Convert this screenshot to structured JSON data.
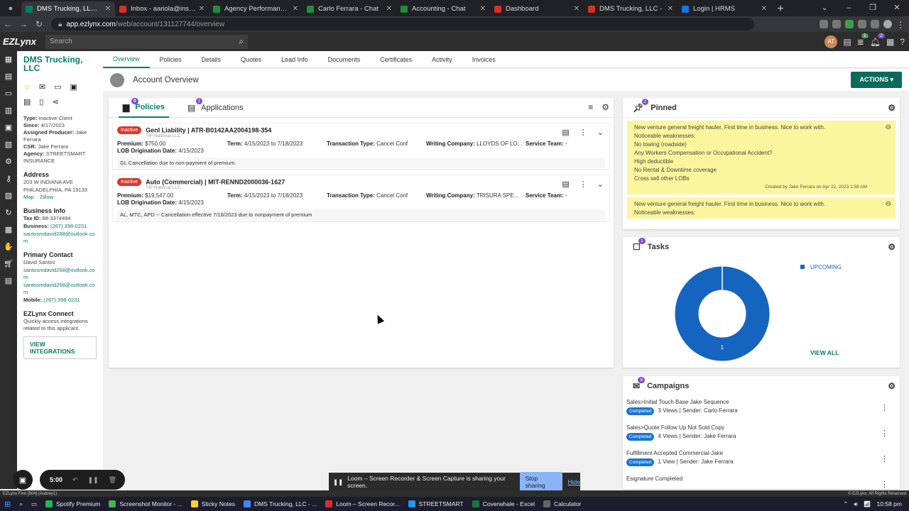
{
  "browser": {
    "tabs": [
      {
        "label": "DMS Trucking, LLC - Acc",
        "color": "#0b7a6b"
      },
      {
        "label": "Inbox - aariola@insboss.",
        "color": "#d93025"
      },
      {
        "label": "Agency Performance Pac",
        "color": "#1e8e3e"
      },
      {
        "label": "Carlo Ferrara - Chat",
        "color": "#1e8e3e"
      },
      {
        "label": "Accounting - Chat",
        "color": "#1e8e3e"
      },
      {
        "label": "Dashboard",
        "color": "#d93025"
      },
      {
        "label": "DMS Trucking, LLC -",
        "color": "#d93025"
      },
      {
        "label": "Login | HRMS",
        "color": "#1a73e8"
      }
    ],
    "url_host": "app.ezlynx.com",
    "url_path": "/web/account/131127744/overview"
  },
  "header": {
    "logo": "EZLynx",
    "search_placeholder": "Search",
    "user_initials": "AT",
    "badges": [
      "1",
      "2"
    ]
  },
  "rail_icons": [
    "dashboard-icon",
    "contacts-icon",
    "folder-icon",
    "structure-icon",
    "id-card-icon",
    "report-icon",
    "settings-icon",
    "key-icon",
    "book-icon",
    "refresh-icon",
    "briefcase-icon",
    "hand-icon",
    "cart-icon",
    "inbox-icon"
  ],
  "account": {
    "name": "DMS Trucking, LLC",
    "type_label": "Type:",
    "type": "Inactive Client",
    "since_label": "Since:",
    "since": "4/17/2023",
    "producer_label": "Assigned Producer:",
    "producer": "Jake Ferrara",
    "csr_label": "CSR:",
    "csr": "Jake Ferrara",
    "agency_label": "Agency:",
    "agency": "STREETSMART INSURANCE",
    "address_heading": "Address",
    "address_line1": "203 W INDIANA AVE",
    "address_line2": "PHILADELPHIA, PA 19133",
    "map_link": "Map",
    "zillow_link": "Zillow",
    "business_heading": "Business Info",
    "taxid_label": "Tax ID:",
    "taxid": "88-3374494",
    "business_label": "Business:",
    "business_phone": "(267) 398-0231",
    "business_email": "santosmdavid268@outlook.com",
    "contact_heading": "Primary Contact",
    "contact_name": "David Santos",
    "contact_email1": "santosmdavid268@outlook.com",
    "contact_email2": "santosmdavid268@outlook.com",
    "mobile_label": "Mobile:",
    "mobile": "(267) 398-0231",
    "connect_heading": "EZLynx Connect",
    "connect_desc": "Quickly access integrations related to this applicant.",
    "view_integrations": "VIEW INTEGRATIONS"
  },
  "topnav": [
    "Overview",
    "Policies",
    "Details",
    "Quotes",
    "Lead Info",
    "Documents",
    "Certificates",
    "Activity",
    "Invoices"
  ],
  "overview": {
    "title": "Account Overview",
    "actions_label": "ACTIONS"
  },
  "policies_card": {
    "tab_policies": "Policies",
    "policies_count": "0",
    "tab_applications": "Applications",
    "applications_count": "1",
    "policies": [
      {
        "status": "Inactive",
        "name": "Genl Liability | ATR-B0142AA2004198-354",
        "carrier": "TIP National LLC",
        "premium_label": "Premium:",
        "premium": "$750.00",
        "term_label": "Term:",
        "term": "4/15/2023 to 7/18/2023",
        "ttype_label": "Transaction Type:",
        "ttype": "Cancel Conf",
        "writing_label": "Writing Company:",
        "writing": "LLOYDS OF LO...",
        "team_label": "Service Team:",
        "team": "-",
        "lob_label": "LOB Origination Date:",
        "lob": "4/15/2023",
        "note": "GL Cancellation due to non-payment of premium."
      },
      {
        "status": "Inactive",
        "name": "Auto (Commercial) | MIT-RENND2000036-1627",
        "carrier": "TIP National LLC",
        "premium_label": "Premium:",
        "premium": "$19,547.00",
        "term_label": "Term:",
        "term": "4/15/2023 to 7/18/2023",
        "ttype_label": "Transaction Type:",
        "ttype": "Cancel Conf",
        "writing_label": "Writing Company:",
        "writing": "TRISURA SPE...",
        "team_label": "Service Team:",
        "team": "-",
        "lob_label": "LOB Origination Date:",
        "lob": "4/15/2023",
        "note": "AL, MTC, APD -- Cancellation effective 7/18/2023 due to nonpayment of premium"
      }
    ]
  },
  "pinned": {
    "title": "Pinned",
    "count": "2",
    "note1_lines": [
      "New venture general freight hauler. First time in business. Nice to work with.",
      "Noticeable weaknesses:",
      "No towing (roadside)",
      "Any Workers Compensation or Occupational Accident?",
      "High deductible",
      "No Rental & Downtime coverage",
      "Cross sell other LOBs"
    ],
    "note1_footer": "Created by Jake Ferrara on Apr 22, 2023 1:58 AM",
    "note2_lines": [
      "New venture general freight hauler. First time in business. Nice to work with.",
      "Noticeable weaknesses:"
    ]
  },
  "tasks": {
    "title": "Tasks",
    "count": "1",
    "legend": "UPCOMING",
    "donut_label": "1",
    "view_all": "VIEW ALL",
    "color": "#1565c0"
  },
  "chart_data": {
    "type": "pie",
    "categories": [
      "UPCOMING"
    ],
    "values": [
      1
    ]
  },
  "campaigns": {
    "title": "Campaigns",
    "count": "8",
    "items": [
      {
        "name": "Sales>Initial Touch Base Jake Sequence",
        "status": "Completed",
        "stats": "3 Views | Sender: Carlo Ferrara"
      },
      {
        "name": "Sales>Quote Follow Up Not Sold Copy",
        "status": "Completed",
        "stats": "4 Views | Sender: Jake Ferrara"
      },
      {
        "name": "Fulfillment Accepted Commercial-Jake",
        "status": "Completed",
        "stats": "1 View | Sender: Jake Ferrara"
      },
      {
        "name": "Esignature Completed",
        "status": "",
        "stats": ""
      }
    ]
  },
  "loom": {
    "timer": "5:00",
    "share_text": "Loom – Screen Recorder & Screen Capture is sharing your screen.",
    "stop": "Stop sharing",
    "hide": "Hide"
  },
  "status": {
    "left": "EZLynx Five [804] (Audrey1)",
    "right": "© EZLynx. All Rights Reserved"
  },
  "taskbar": {
    "items": [
      {
        "label": "Spotify Premium",
        "color": "#1db954"
      },
      {
        "label": "Screenshot Monitor - ...",
        "color": "#4caf50"
      },
      {
        "label": "Sticky Notes",
        "color": "#f6d32d"
      },
      {
        "label": "DMS Trucking, LLC - ...",
        "color": "#4285f4"
      },
      {
        "label": "Loom – Screen Recor...",
        "color": "#d93025"
      },
      {
        "label": "STREETSMART",
        "color": "#2196f3"
      },
      {
        "label": "Coverwhale - Excel",
        "color": "#1e7145"
      },
      {
        "label": "Calculator",
        "color": "#666666"
      }
    ],
    "time": "10:58 pm"
  }
}
